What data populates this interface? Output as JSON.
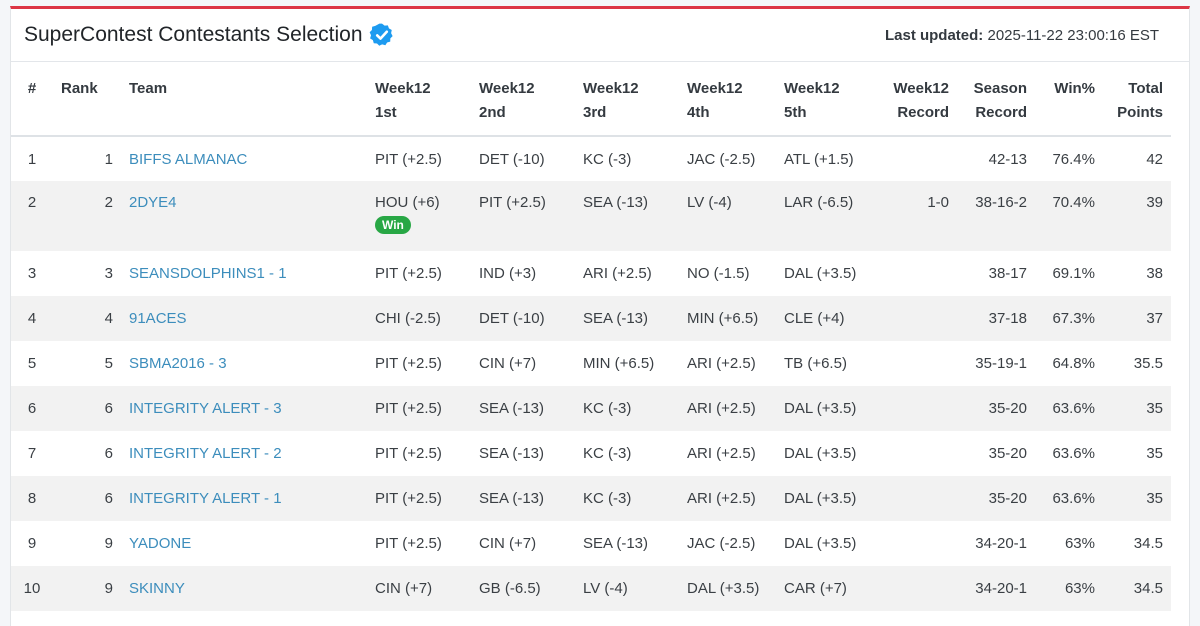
{
  "header": {
    "title": "SuperContest Contestants Selection",
    "updated_label": "Last updated:",
    "updated_value": "2025-11-22 23:00:16 EST"
  },
  "colors": {
    "accent": "#dc3545",
    "link": "#3c8dbc",
    "win_badge": "#28a745",
    "verified": "#1d9bf0"
  },
  "columns": [
    {
      "line1": "#",
      "line2": ""
    },
    {
      "line1": "Rank",
      "line2": ""
    },
    {
      "line1": "Team",
      "line2": ""
    },
    {
      "line1": "Week12",
      "line2": "1st"
    },
    {
      "line1": "Week12",
      "line2": "2nd"
    },
    {
      "line1": "Week12",
      "line2": "3rd"
    },
    {
      "line1": "Week12",
      "line2": "4th"
    },
    {
      "line1": "Week12",
      "line2": "5th"
    },
    {
      "line1": "Week12",
      "line2": "Record"
    },
    {
      "line1": "Season",
      "line2": "Record"
    },
    {
      "line1": "Win%",
      "line2": ""
    },
    {
      "line1": "Total",
      "line2": "Points"
    }
  ],
  "rows": [
    {
      "num": "1",
      "rank": "1",
      "team": "BIFFS ALMANAC",
      "p1": "PIT (+2.5)",
      "p1_badge": "",
      "p2": "DET (-10)",
      "p3": "KC (-3)",
      "p4": "JAC (-2.5)",
      "p5": "ATL (+1.5)",
      "week_record": "",
      "season_record": "42-13",
      "win_pct": "76.4%",
      "total": "42"
    },
    {
      "num": "2",
      "rank": "2",
      "team": "2DYE4",
      "p1": "HOU (+6)",
      "p1_badge": "Win",
      "p2": "PIT (+2.5)",
      "p3": "SEA (-13)",
      "p4": "LV (-4)",
      "p5": "LAR (-6.5)",
      "week_record": "1-0",
      "season_record": "38-16-2",
      "win_pct": "70.4%",
      "total": "39"
    },
    {
      "num": "3",
      "rank": "3",
      "team": "SEANSDOLPHINS1 - 1",
      "p1": "PIT (+2.5)",
      "p1_badge": "",
      "p2": "IND (+3)",
      "p3": "ARI (+2.5)",
      "p4": "NO (-1.5)",
      "p5": "DAL (+3.5)",
      "week_record": "",
      "season_record": "38-17",
      "win_pct": "69.1%",
      "total": "38"
    },
    {
      "num": "4",
      "rank": "4",
      "team": "91ACES",
      "p1": "CHI (-2.5)",
      "p1_badge": "",
      "p2": "DET (-10)",
      "p3": "SEA (-13)",
      "p4": "MIN (+6.5)",
      "p5": "CLE (+4)",
      "week_record": "",
      "season_record": "37-18",
      "win_pct": "67.3%",
      "total": "37"
    },
    {
      "num": "5",
      "rank": "5",
      "team": "SBMA2016 - 3",
      "p1": "PIT (+2.5)",
      "p1_badge": "",
      "p2": "CIN (+7)",
      "p3": "MIN (+6.5)",
      "p4": "ARI (+2.5)",
      "p5": "TB (+6.5)",
      "week_record": "",
      "season_record": "35-19-1",
      "win_pct": "64.8%",
      "total": "35.5"
    },
    {
      "num": "6",
      "rank": "6",
      "team": "INTEGRITY ALERT - 3",
      "p1": "PIT (+2.5)",
      "p1_badge": "",
      "p2": "SEA (-13)",
      "p3": "KC (-3)",
      "p4": "ARI (+2.5)",
      "p5": "DAL (+3.5)",
      "week_record": "",
      "season_record": "35-20",
      "win_pct": "63.6%",
      "total": "35"
    },
    {
      "num": "7",
      "rank": "6",
      "team": "INTEGRITY ALERT - 2",
      "p1": "PIT (+2.5)",
      "p1_badge": "",
      "p2": "SEA (-13)",
      "p3": "KC (-3)",
      "p4": "ARI (+2.5)",
      "p5": "DAL (+3.5)",
      "week_record": "",
      "season_record": "35-20",
      "win_pct": "63.6%",
      "total": "35"
    },
    {
      "num": "8",
      "rank": "6",
      "team": "INTEGRITY ALERT - 1",
      "p1": "PIT (+2.5)",
      "p1_badge": "",
      "p2": "SEA (-13)",
      "p3": "KC (-3)",
      "p4": "ARI (+2.5)",
      "p5": "DAL (+3.5)",
      "week_record": "",
      "season_record": "35-20",
      "win_pct": "63.6%",
      "total": "35"
    },
    {
      "num": "9",
      "rank": "9",
      "team": "YADONE",
      "p1": "PIT (+2.5)",
      "p1_badge": "",
      "p2": "CIN (+7)",
      "p3": "SEA (-13)",
      "p4": "JAC (-2.5)",
      "p5": "DAL (+3.5)",
      "week_record": "",
      "season_record": "34-20-1",
      "win_pct": "63%",
      "total": "34.5"
    },
    {
      "num": "10",
      "rank": "9",
      "team": "SKINNY",
      "p1": "CIN (+7)",
      "p1_badge": "",
      "p2": "GB (-6.5)",
      "p3": "LV (-4)",
      "p4": "DAL (+3.5)",
      "p5": "CAR (+7)",
      "week_record": "",
      "season_record": "34-20-1",
      "win_pct": "63%",
      "total": "34.5"
    }
  ]
}
